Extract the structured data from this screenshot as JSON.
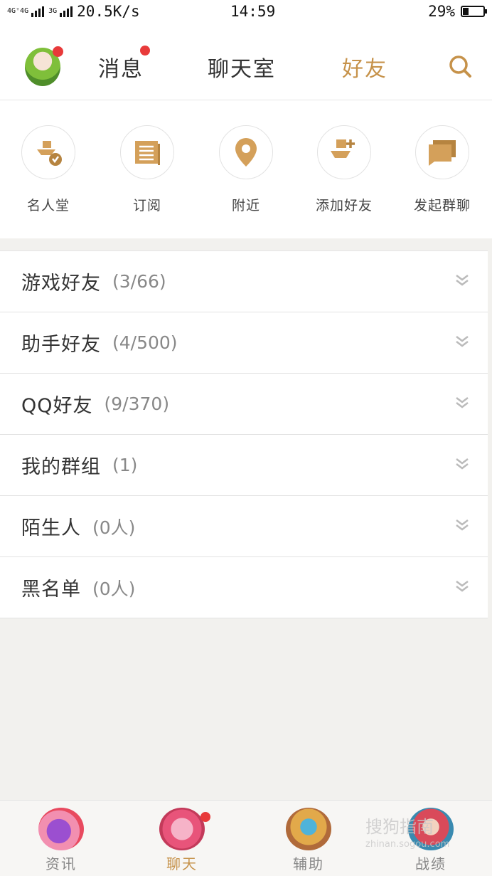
{
  "status_bar": {
    "network": "4G⁺4G",
    "network2": "3G",
    "speed": "20.5K/s",
    "time": "14:59",
    "battery_percent": "29%",
    "battery_level": 0.29
  },
  "topnav": {
    "tabs": [
      {
        "label": "消息",
        "has_dot": true
      },
      {
        "label": "聊天室",
        "has_dot": false
      },
      {
        "label": "好友",
        "active": true
      }
    ],
    "search_icon": "search-icon"
  },
  "quick_actions": [
    {
      "label": "名人堂",
      "icon": "hall-of-fame-icon"
    },
    {
      "label": "订阅",
      "icon": "subscribe-icon"
    },
    {
      "label": "附近",
      "icon": "location-pin-icon"
    },
    {
      "label": "添加好友",
      "icon": "add-friend-icon"
    },
    {
      "label": "发起群聊",
      "icon": "group-chat-icon"
    }
  ],
  "groups": [
    {
      "name": "游戏好友",
      "count": "(3/66)"
    },
    {
      "name": "助手好友",
      "count": "(4/500)"
    },
    {
      "name": "QQ好友",
      "count": "(9/370)"
    },
    {
      "name": "我的群组",
      "count": "(1)"
    },
    {
      "name": "陌生人",
      "count": "(0人)"
    },
    {
      "name": "黑名单",
      "count": "(0人)"
    }
  ],
  "tabbar": [
    {
      "label": "资讯",
      "active": false
    },
    {
      "label": "聊天",
      "active": true,
      "has_dot": true
    },
    {
      "label": "辅助",
      "active": false
    },
    {
      "label": "战绩",
      "active": false
    }
  ],
  "watermark": {
    "text": "搜狗指南",
    "sub": "zhinan.sogou.com"
  },
  "colors": {
    "accent": "#c6924a",
    "dot": "#e83a3a",
    "background": "#f2f1ee"
  }
}
